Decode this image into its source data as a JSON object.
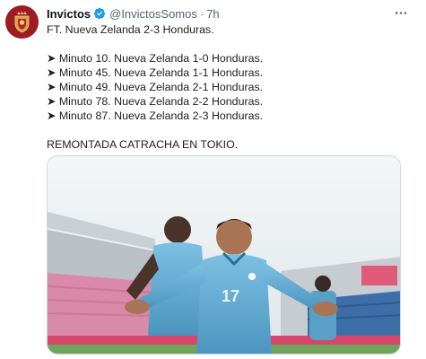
{
  "tweet": {
    "display_name": "Invictos",
    "handle": "@InvictosSomos",
    "separator": "·",
    "time": "7h",
    "verified_icon": "verified-badge-icon",
    "more_icon": "more-horizontal-icon",
    "lines": [
      "FT. Nueva Zelanda 2-3 Honduras.",
      "",
      "➤ Minuto 10. Nueva Zelanda 1-0 Honduras.",
      "➤ Minuto 45. Nueva Zelanda 1-1 Honduras.",
      "➤ Minuto 49. Nueva Zelanda 2-1 Honduras.",
      "➤ Minuto 78. Nueva Zelanda 2-2 Honduras.",
      "➤ Minuto 87. Nueva Zelanda 2-3 Honduras.",
      "",
      "REMONTADA CATRACHA EN TOKIO."
    ],
    "jersey_number": "17"
  },
  "colors": {
    "verified": "#1d9bf0",
    "jersey": "#5aa6cf",
    "avatar": "#9e1b21"
  }
}
